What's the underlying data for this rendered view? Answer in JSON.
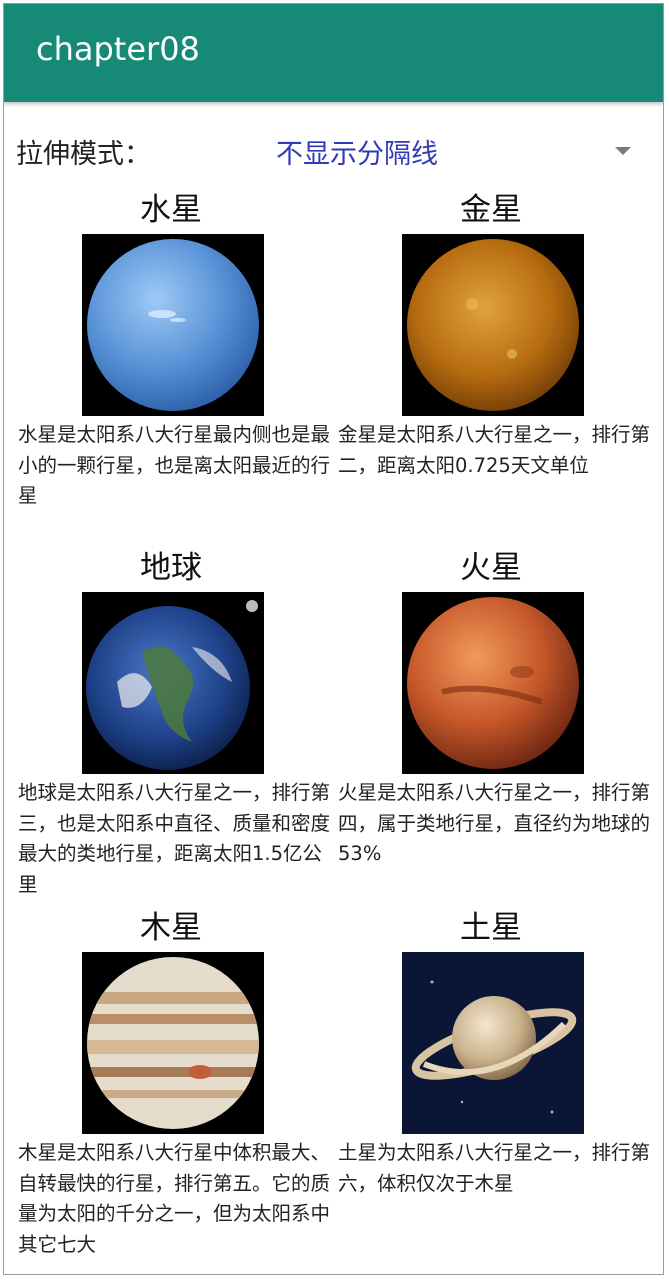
{
  "app": {
    "title": "chapter08",
    "accent_color": "#178a77"
  },
  "mode": {
    "label": "拉伸模式：",
    "selected": "不显示分隔线",
    "value_color": "#2f3bb6"
  },
  "planets": [
    {
      "name": "水星",
      "description": "水星是太阳系八大行星最内侧也是最小的一颗行星，也是离太阳最近的行星",
      "image": "mercury-image"
    },
    {
      "name": "金星",
      "description": "金星是太阳系八大行星之一，排行第二，距离太阳0.725天文单位",
      "image": "venus-image"
    },
    {
      "name": "地球",
      "description": "地球是太阳系八大行星之一，排行第三，也是太阳系中直径、质量和密度最大的类地行星，距离太阳1.5亿公里",
      "image": "earth-image"
    },
    {
      "name": "火星",
      "description": "火星是太阳系八大行星之一，排行第四，属于类地行星，直径约为地球的53%",
      "image": "mars-image"
    },
    {
      "name": "木星",
      "description": "木星是太阳系八大行星中体积最大、自转最快的行星，排行第五。它的质量为太阳的千分之一，但为太阳系中其它七大",
      "image": "jupiter-image"
    },
    {
      "name": "土星",
      "description": "土星为太阳系八大行星之一，排行第六，体积仅次于木星",
      "image": "saturn-image"
    }
  ]
}
